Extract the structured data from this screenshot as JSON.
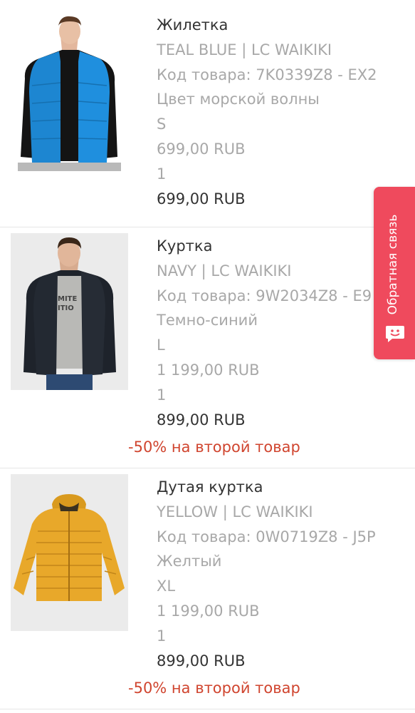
{
  "items": [
    {
      "name": "Жилетка",
      "brand_line": "TEAL BLUE | LC WAIKIKI",
      "sku_line": "Код товара: 7K0339Z8 - EX2",
      "color": "Цвет морской волны",
      "size": "S",
      "unit_price": "699,00 RUB",
      "quantity": "1",
      "total": "699,00 RUB",
      "image_icon": "vest-product-photo"
    },
    {
      "name": "Куртка",
      "brand_line": "NAVY | LC WAIKIKI",
      "sku_line": "Код товара: 9W2034Z8 - E9",
      "color": "Темно-синий",
      "size": "L",
      "unit_price": "1 199,00 RUB",
      "quantity": "1",
      "total": "899,00 RUB",
      "promo": "-50% на второй товар",
      "image_icon": "jacket-product-photo"
    },
    {
      "name": "Дутая куртка",
      "brand_line": "YELLOW | LC WAIKIKI",
      "sku_line": "Код товара: 0W0719Z8 - J5P",
      "color": "Желтый",
      "size": "XL",
      "unit_price": "1 199,00 RUB",
      "quantity": "1",
      "total": "899,00 RUB",
      "promo": "-50% на второй товар",
      "image_icon": "puffer-jacket-product-photo"
    }
  ],
  "feedback": {
    "label": "Обратная связь",
    "icon": "chat-icon",
    "color": "#ef4a5d"
  },
  "colors": {
    "text_dark": "#333333",
    "text_light": "#a8a8a8",
    "promo": "#d0452f"
  }
}
